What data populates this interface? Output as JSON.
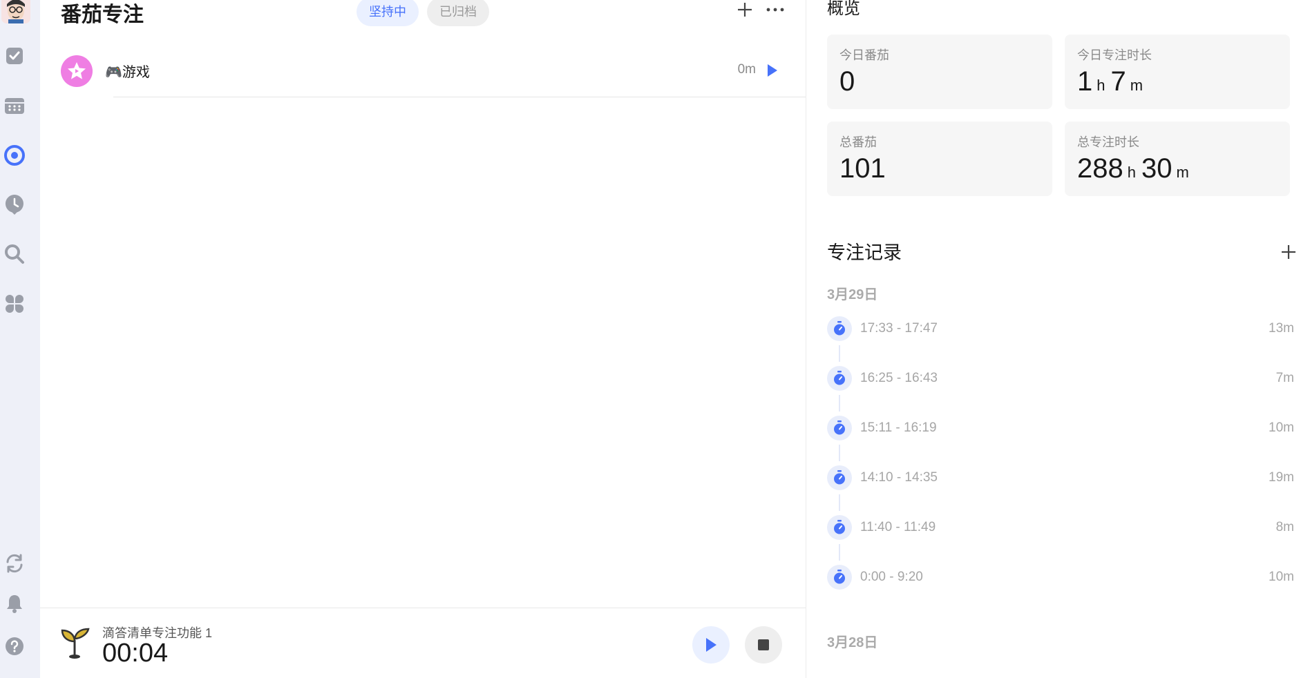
{
  "sidebar": {
    "icons": [
      "avatar",
      "checkbox-icon",
      "calendar-icon",
      "focus-icon",
      "clock-icon",
      "search-icon",
      "apps-icon",
      "sync-icon",
      "bell-icon",
      "help-icon"
    ],
    "accent": "#4772fa"
  },
  "main": {
    "title": "番茄专注",
    "tabs": [
      {
        "label": "坚持中",
        "active": true
      },
      {
        "label": "已归档",
        "active": false
      }
    ],
    "habits": [
      {
        "name": "🎮游戏",
        "time": "0m",
        "icon_color": "#ef7ee3"
      }
    ]
  },
  "footer": {
    "task": "滴答清单专注功能 1",
    "timer": "00:04"
  },
  "overview": {
    "title": "概览",
    "cards": [
      {
        "label": "今日番茄",
        "parts": [
          {
            "num": "0"
          }
        ]
      },
      {
        "label": "今日专注时长",
        "parts": [
          {
            "num": "1",
            "unit": "h"
          },
          {
            "num": "7",
            "unit": "m"
          }
        ]
      },
      {
        "label": "总番茄",
        "parts": [
          {
            "num": "101"
          }
        ]
      },
      {
        "label": "总专注时长",
        "parts": [
          {
            "num": "288",
            "unit": "h"
          },
          {
            "num": "30",
            "unit": "m"
          }
        ]
      }
    ]
  },
  "records": {
    "title": "专注记录",
    "days": [
      {
        "date": "3月29日",
        "items": [
          {
            "range": "17:33 - 17:47",
            "duration": "13m"
          },
          {
            "range": "16:25 - 16:43",
            "duration": "7m"
          },
          {
            "range": "15:11 - 16:19",
            "duration": "10m"
          },
          {
            "range": "14:10 - 14:35",
            "duration": "19m"
          },
          {
            "range": "11:40 - 11:49",
            "duration": "8m"
          },
          {
            "range": "0:00 - 9:20",
            "duration": "10m"
          }
        ]
      },
      {
        "date": "3月28日",
        "items": []
      }
    ]
  }
}
